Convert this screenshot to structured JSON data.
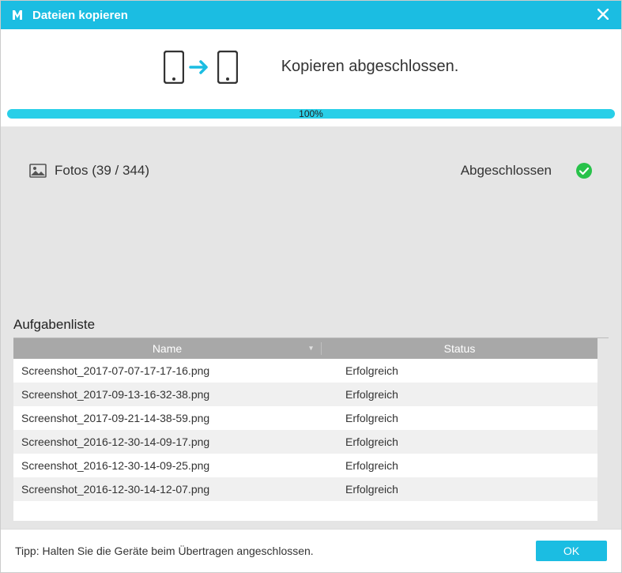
{
  "titlebar": {
    "title": "Dateien kopieren"
  },
  "status": {
    "message": "Kopieren abgeschlossen."
  },
  "progress": {
    "percent_text": "100%"
  },
  "summary": {
    "category_label": "Fotos (39 / 344)",
    "state_label": "Abgeschlossen"
  },
  "tasklist": {
    "title": "Aufgabenliste",
    "columns": {
      "name": "Name",
      "status": "Status"
    },
    "rows": [
      {
        "name": "Screenshot_2017-07-07-17-17-16.png",
        "status": "Erfolgreich"
      },
      {
        "name": "Screenshot_2017-09-13-16-32-38.png",
        "status": "Erfolgreich"
      },
      {
        "name": "Screenshot_2017-09-21-14-38-59.png",
        "status": "Erfolgreich"
      },
      {
        "name": "Screenshot_2016-12-30-14-09-17.png",
        "status": "Erfolgreich"
      },
      {
        "name": "Screenshot_2016-12-30-14-09-25.png",
        "status": "Erfolgreich"
      },
      {
        "name": "Screenshot_2016-12-30-14-12-07.png",
        "status": "Erfolgreich"
      }
    ]
  },
  "footer": {
    "tip": "Tipp: Halten Sie die Geräte beim Übertragen angeschlossen.",
    "ok": "OK"
  }
}
